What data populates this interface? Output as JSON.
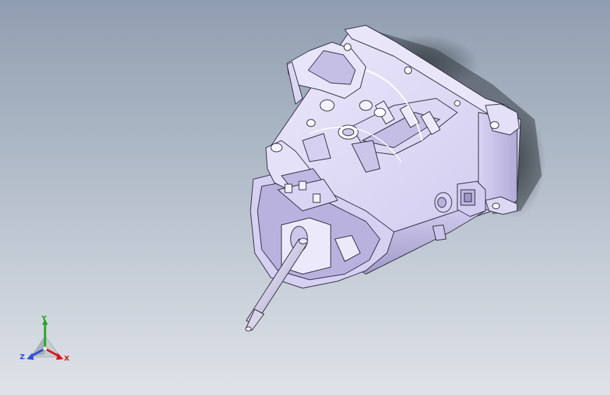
{
  "colors": {
    "background_top": "#8f9eb0",
    "background_bottom": "#dfe3e9",
    "part_fill": "#e2def6",
    "part_shade": "#c3bde2",
    "part_dark": "#8d86b5",
    "part_edge": "#2c2a3a",
    "shadow": "#3a4046",
    "axis_x": "#d31c1c",
    "axis_y": "#1ea51e",
    "axis_z": "#2a4fd8"
  },
  "triad": {
    "x_label": "X",
    "y_label": "Y",
    "z_label": "Z"
  }
}
